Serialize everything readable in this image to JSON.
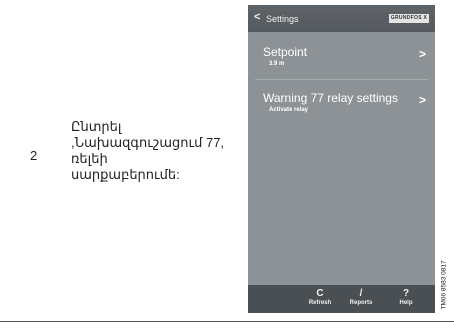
{
  "step": {
    "number": "2",
    "lines": [
      "Ընտրել",
      ",Նախազգուշացում 77,",
      "ռելեի",
      "սարքաբերումե:"
    ]
  },
  "screen": {
    "header": {
      "back": "<",
      "title": "Settings",
      "brand": "GRUNDFOS X"
    },
    "items": [
      {
        "title": "Setpoint",
        "subtitle": "3.9 m",
        "chevron": ">"
      },
      {
        "title": "Warning 77 relay settings",
        "subtitle": "Activate relay",
        "chevron": ">"
      }
    ],
    "footer": [
      {
        "icon": "C",
        "label": "Refresh",
        "icon_name": "refresh-icon"
      },
      {
        "icon": "/",
        "label": "Reports",
        "icon_name": "reports-icon"
      },
      {
        "icon": "?",
        "label": "Help",
        "icon_name": "help-icon"
      }
    ]
  },
  "figure_code": "TM06 8583 0817"
}
